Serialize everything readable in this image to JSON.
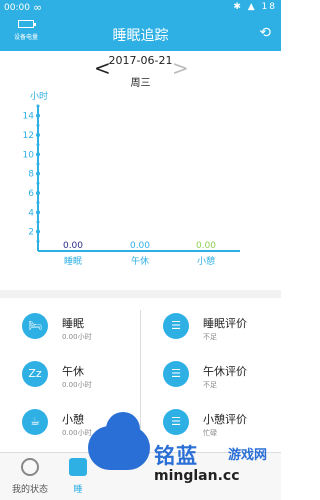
{
  "status_bar": {
    "time": "00:00",
    "infinity": "∞",
    "icons": "✱ ▲ 18"
  },
  "header": {
    "title": "睡眠追踪",
    "device_battery_label": "设备电量",
    "share_icon": "share-icon"
  },
  "date_nav": {
    "date": "2017-06-21",
    "weekday": "周三",
    "prev": "<",
    "next": ">"
  },
  "chart_data": {
    "type": "bar",
    "categories": [
      "睡眠",
      "午休",
      "小憩"
    ],
    "values": [
      0.0,
      0.0,
      0.0
    ],
    "value_labels": [
      "0.00",
      "0.00",
      "0.00"
    ],
    "value_label_colors": [
      "#2c2c8a",
      "#2fb0e4",
      "#8fd14f"
    ],
    "ylabel": "小时",
    "yticks": [
      2,
      4,
      6,
      8,
      10,
      12,
      14
    ],
    "ylim": [
      0,
      15
    ],
    "axis_color": "#2fb0e4"
  },
  "stats": [
    {
      "icon": "bed-icon",
      "glyph": "🛏",
      "name": "睡眠",
      "value": "0.00小时"
    },
    {
      "icon": "zz-icon",
      "glyph": "Zz",
      "name": "午休",
      "value": "0.00小时"
    },
    {
      "icon": "cup-icon",
      "glyph": "☕",
      "name": "小憩",
      "value": "0.00小时"
    },
    {
      "icon": "list-icon",
      "glyph": "☰",
      "name": "睡眠评价",
      "value": "不足"
    },
    {
      "icon": "list-icon",
      "glyph": "☰",
      "name": "午休评价",
      "value": "不足"
    },
    {
      "icon": "list-icon",
      "glyph": "☰",
      "name": "小憩评价",
      "value": "忙碌"
    }
  ],
  "tabs": [
    {
      "label": "我的状态",
      "active": false
    },
    {
      "label": "睡",
      "active": true
    }
  ],
  "watermark": {
    "t1": "铭蓝",
    "t2": "游戏网",
    "t3": "minglan.cc"
  }
}
